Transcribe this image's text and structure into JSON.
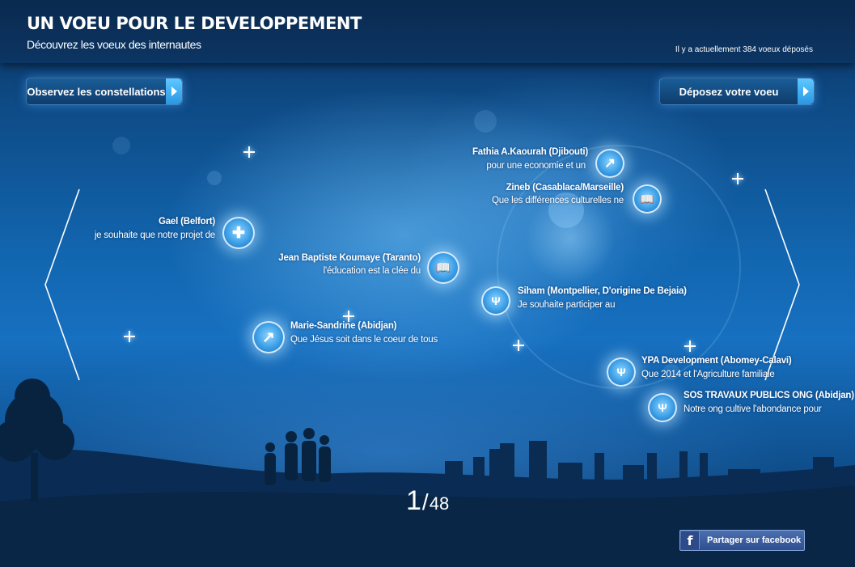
{
  "header": {
    "title": "UN VOEU POUR LE DEVELOPPEMENT",
    "subtitle": "Découvrez les voeux des internautes",
    "count_text": "Il y a actuellement 384 voeux déposés"
  },
  "nav": {
    "constellations_label": "Observez les constellations",
    "deposer_label": "Déposez votre voeu"
  },
  "wishes": [
    {
      "name": "Fathia  A.Kaourah (Djibouti)",
      "text": "pour une economie et un",
      "icon": "arrow-up-right-icon"
    },
    {
      "name": "Zineb (Casablaca/Marseille)",
      "text": "Que les différences culturelles ne",
      "icon": "book-icon"
    },
    {
      "name": "Gael (Belfort)",
      "text": "je souhaite que notre projet de",
      "icon": "health-cross-icon"
    },
    {
      "name": "Jean Baptiste Koumaye (Taranto)",
      "text": "l'éducation est la clée du",
      "icon": "book-icon"
    },
    {
      "name": "Siham (Montpellier, D'origine De Bejaia)",
      "text": "Je souhaite participer au",
      "icon": "wheat-icon"
    },
    {
      "name": "Marie-Sandrine (Abidjan)",
      "text": "Que Jésus soit dans le coeur de tous",
      "icon": "arrow-up-right-icon"
    },
    {
      "name": "YPA Development (Abomey-Calavi)",
      "text": "Que 2014 et l'Agriculture familiale",
      "icon": "wheat-icon"
    },
    {
      "name": "SOS TRAVAUX PUBLICS ONG (Abidjan)",
      "text": "Notre ong cultive l'abondance pour",
      "icon": "wheat-icon"
    }
  ],
  "pager": {
    "current": "1",
    "separator": "/",
    "total": "48"
  },
  "facebook": {
    "label": "Partager sur  facebook",
    "icon_glyph": "f"
  }
}
